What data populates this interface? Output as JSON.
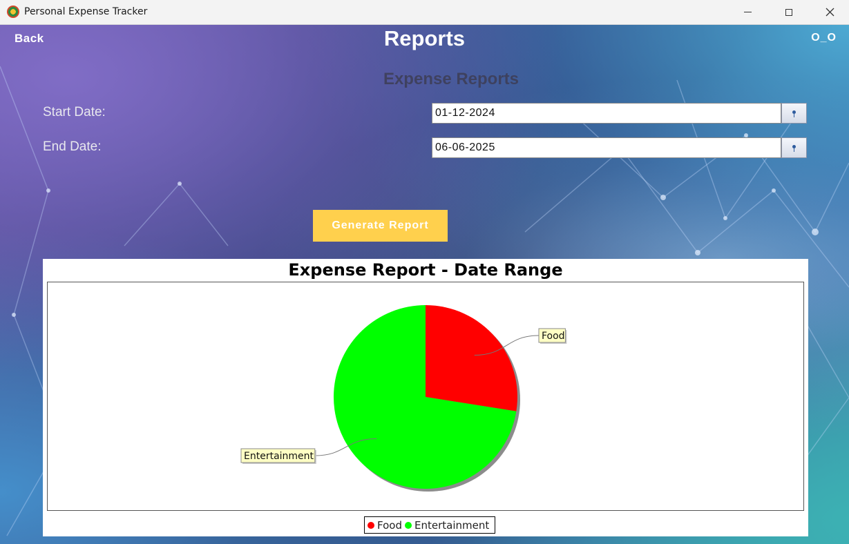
{
  "window": {
    "title": "Personal Expense Tracker"
  },
  "header": {
    "back_label": "Back",
    "title": "Reports",
    "user_badge": "O_O"
  },
  "form": {
    "section_title": "Expense Reports",
    "start_label": "Start Date:",
    "start_value": "01-12-2024",
    "end_label": "End Date:",
    "end_value": "06-06-2025",
    "generate_label": "Generate Report"
  },
  "colors": {
    "accent_button": "#ffd04d",
    "food": "#ff0000",
    "entertainment": "#00ff00"
  },
  "chart_data": {
    "type": "pie",
    "title": "Expense Report - Date Range",
    "categories": [
      "Food",
      "Entertainment"
    ],
    "values": [
      27.5,
      72.5
    ],
    "colors": [
      "#ff0000",
      "#00ff00"
    ],
    "legend": "bottom-center"
  }
}
